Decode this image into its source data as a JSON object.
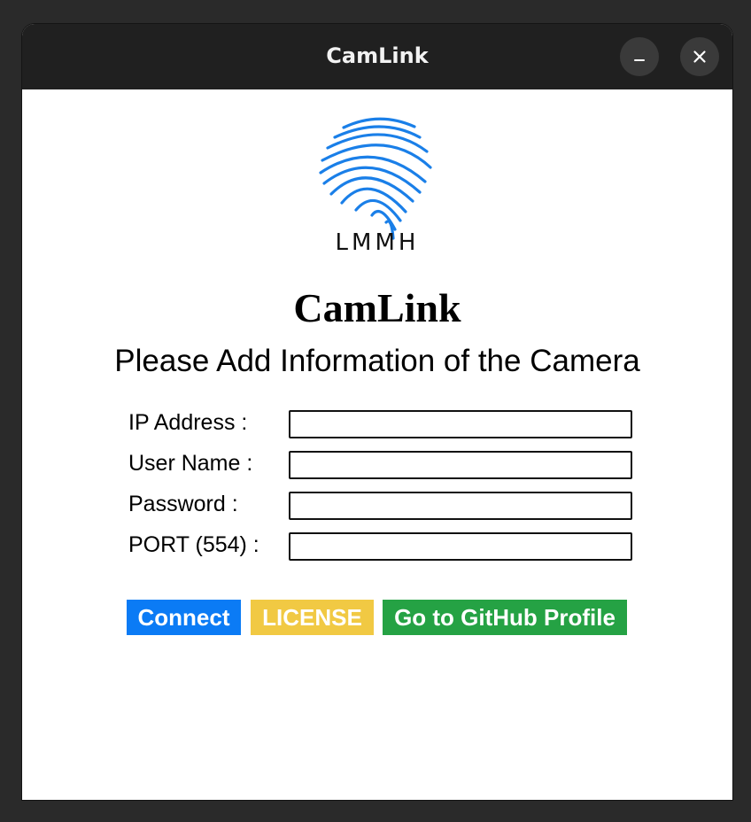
{
  "window": {
    "title": "CamLink",
    "minimize_glyph": "–",
    "close_glyph": "×"
  },
  "logo": {
    "icon": "fingerprint-icon",
    "text": "LMMH",
    "color": "#1a7fe8"
  },
  "heading": "CamLink",
  "subheading": "Please Add Information of the Camera",
  "form": {
    "fields": [
      {
        "label": "IP Address :",
        "value": "",
        "placeholder": ""
      },
      {
        "label": "User Name :",
        "value": "",
        "placeholder": ""
      },
      {
        "label": "Password :",
        "value": "",
        "placeholder": ""
      },
      {
        "label": "PORT (554) :",
        "value": "",
        "placeholder": ""
      }
    ]
  },
  "buttons": {
    "connect": {
      "label": "Connect",
      "color": "#0b7bf5"
    },
    "license": {
      "label": "LICENSE",
      "color": "#f1c943"
    },
    "github": {
      "label": "Go to GitHub Profile",
      "color": "#25a244"
    }
  }
}
